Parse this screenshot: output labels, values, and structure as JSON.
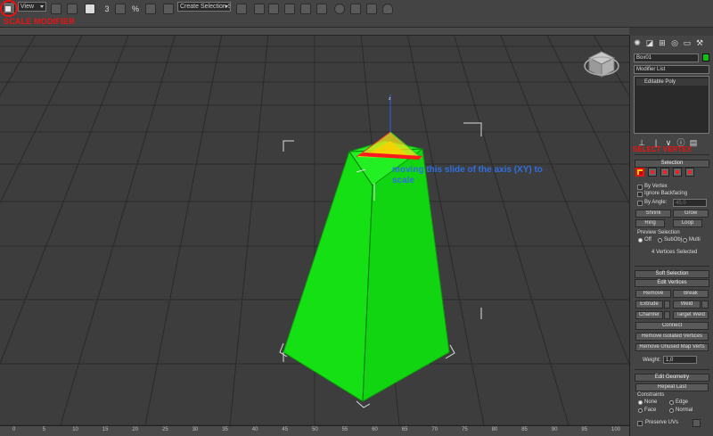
{
  "toolbar": {
    "view_dropdown": "View",
    "selection_set_dropdown": "Create Selection S",
    "snap_label": "3",
    "percent_label": "%",
    "annotation_scale_modifier": "SCALE MODIFIER"
  },
  "viewport": {
    "annotation_text": "moving this slide of the axis (XY) to scale"
  },
  "timeline": {
    "ticks": [
      "0",
      "5",
      "10",
      "15",
      "20",
      "25",
      "30",
      "35",
      "40",
      "45",
      "50",
      "55",
      "60",
      "65",
      "70",
      "75",
      "80",
      "85",
      "90",
      "95",
      "100"
    ]
  },
  "command_panel": {
    "object_name": "Box01",
    "object_color": "#10c010",
    "modifier_list": "Modifier List",
    "stack_item": "Editable Poly",
    "selection": {
      "title": "Selection",
      "select_vertex_annotation": "SELECT VERTEX",
      "by_vertex": "By Vertex",
      "ignore_backfacing": "Ignore Backfacing",
      "by_angle": "By Angle:",
      "angle_value": "45.0",
      "shrink": "Shrink",
      "grow": "Grow",
      "ring": "Ring",
      "loop": "Loop",
      "preview_selection": "Preview Selection",
      "preview_off": "Off",
      "preview_subobj": "SubObj",
      "preview_multi": "Multi",
      "status": "4 Vertices Selected"
    },
    "soft_selection": {
      "title": "Soft Selection"
    },
    "edit_vertices": {
      "title": "Edit Vertices",
      "remove": "Remove",
      "break": "Break",
      "extrude": "Extrude",
      "weld": "Weld",
      "chamfer": "Chamfer",
      "target_weld": "Target Weld",
      "connect": "Connect",
      "remove_isolated": "Remove Isolated Vertices",
      "remove_unused": "Remove Unused Map Verts",
      "weight_label": "Weight:",
      "weight_value": "1,0"
    },
    "edit_geometry": {
      "title": "Edit Geometry",
      "repeat_last": "Repeat Last",
      "constraints": "Constraints",
      "none": "None",
      "edge": "Edge",
      "face": "Face",
      "normal": "Normal",
      "preserve_uvs": "Preserve UVs"
    }
  }
}
